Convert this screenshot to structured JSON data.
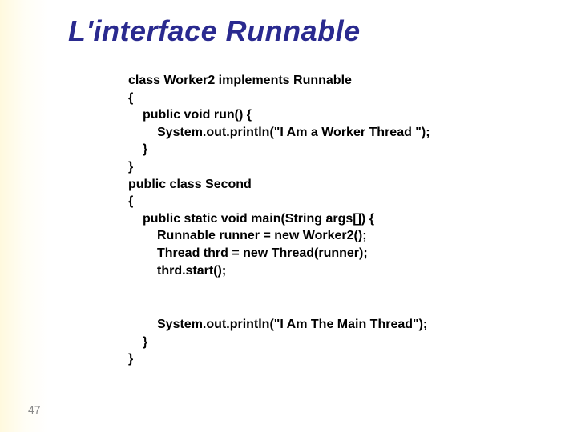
{
  "slide": {
    "title": "L'interface Runnable",
    "page_number": "47"
  },
  "code": {
    "l1": "class Worker2 implements Runnable",
    "l2": "{",
    "l3": "public void run() {",
    "l4": "System.out.println(\"I Am a Worker Thread \");",
    "l5": "}",
    "l6": "}",
    "l7": "public class Second",
    "l8": "{",
    "l9": "public static void main(String args[]) {",
    "l10": "Runnable runner = new Worker2();",
    "l11": "Thread thrd = new Thread(runner);",
    "l12": "thrd.start();",
    "l13": "System.out.println(\"I Am The Main Thread\");",
    "l14": "}",
    "l15": "}"
  }
}
